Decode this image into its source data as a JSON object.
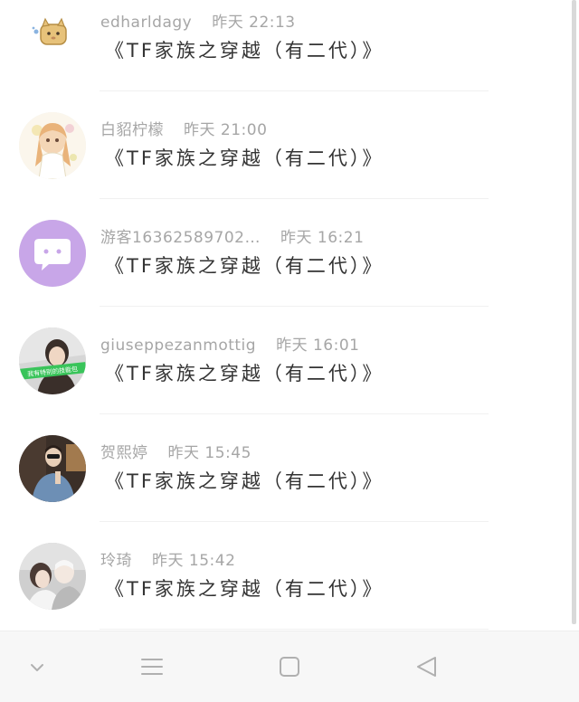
{
  "messages": [
    {
      "username": "edharldagy",
      "time": "昨天 22:13",
      "title": "《TF家族之穿越（有二代）》"
    },
    {
      "username": "白貂柠檬",
      "time": "昨天 21:00",
      "title": "《TF家族之穿越（有二代）》"
    },
    {
      "username": "游客16362589702…",
      "time": "昨天 16:21",
      "title": "《TF家族之穿越（有二代）》"
    },
    {
      "username": "giuseppezanmottig",
      "time": "昨天 16:01",
      "title": "《TF家族之穿越（有二代）》"
    },
    {
      "username": "贺熙婷",
      "time": "昨天 15:45",
      "title": "《TF家族之穿越（有二代）》"
    },
    {
      "username": "玲琦",
      "time": "昨天 15:42",
      "title": "《TF家族之穿越（有二代）》"
    }
  ],
  "avatar_badge_text": "我有特别的技能包",
  "icons": {
    "nav_hide": "chevron-down-icon",
    "nav_menu": "menu-icon",
    "nav_home": "home-square-icon",
    "nav_back": "back-triangle-icon"
  },
  "colors": {
    "username": "#a6a6a6",
    "title": "#333333",
    "divider": "#f1f1f1",
    "navbar_bg": "#f7f7f7",
    "nav_icon": "#b0b0b0",
    "guest_avatar": "#c8a6e8"
  }
}
